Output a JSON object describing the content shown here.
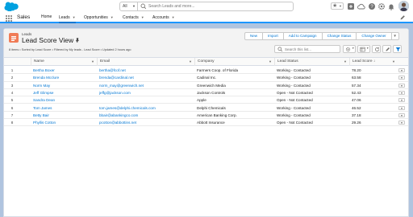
{
  "header": {
    "search_scope": "All",
    "search_placeholder": "Search Leads and more..."
  },
  "app_nav": {
    "app_name": "Sales",
    "items": [
      {
        "label": "Home",
        "has_menu": false
      },
      {
        "label": "Leads",
        "has_menu": true
      },
      {
        "label": "Opportunities",
        "has_menu": true
      },
      {
        "label": "Contacts",
        "has_menu": true
      },
      {
        "label": "Accounts",
        "has_menu": true
      }
    ]
  },
  "list_view": {
    "object_label": "Leads",
    "title": "Lead Score View",
    "info": "8 items • Sorted by Lead Score • Filtered by My leads - Lead Score • Updated 2 hours ago",
    "buttons": [
      "New",
      "Import",
      "Add to Campaign",
      "Change Status",
      "Change Owner"
    ],
    "search_placeholder": "Search this list..."
  },
  "table": {
    "columns": [
      "Name",
      "Email",
      "Company",
      "Lead Status",
      "Lead Score ↓"
    ],
    "rows": [
      {
        "n": "1",
        "name": "Bertha Boxer",
        "email": "bertha@fcof.net",
        "company": "Farmers Coop. of Florida",
        "status": "Working - Contacted",
        "score": "78.20"
      },
      {
        "n": "2",
        "name": "Brenda Mcclure",
        "email": "brenda@cardinal.net",
        "company": "Cadinal Inc.",
        "status": "Working - Contacted",
        "score": "63.58"
      },
      {
        "n": "3",
        "name": "Norm May",
        "email": "norm_may@greenwich.net",
        "company": "Greenwich Media",
        "status": "Working - Contacted",
        "score": "57.34"
      },
      {
        "n": "4",
        "name": "Jeff Glimpse",
        "email": "jeffg@jackson.com",
        "company": "Jackson Controls",
        "status": "Open - Not Contacted",
        "score": "52.43"
      },
      {
        "n": "5",
        "name": "Sandra Dean",
        "email": "",
        "company": "Apple",
        "status": "Open - Not Contacted",
        "score": "47.06"
      },
      {
        "n": "6",
        "name": "Tom James",
        "email": "tom.james@delphi.chemicals.com",
        "company": "Delphi Chemicals",
        "status": "Working - Contacted",
        "score": "46.52"
      },
      {
        "n": "7",
        "name": "Betty Bair",
        "email": "bbair@abankingco.com",
        "company": "American Banking Corp.",
        "status": "Working - Contacted",
        "score": "37.18"
      },
      {
        "n": "8",
        "name": "Phyllis Cotton",
        "email": "pcotton@abbottins.net",
        "company": "Abbott Insurance",
        "status": "Open - Not Contacted",
        "score": "29.26"
      }
    ]
  }
}
